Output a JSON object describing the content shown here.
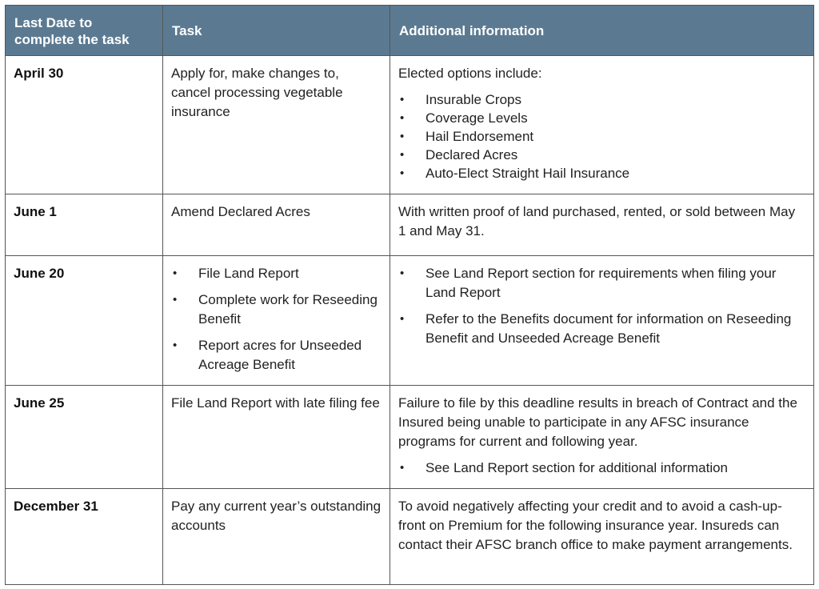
{
  "table": {
    "headers": [
      "Last Date to complete the task",
      "Task",
      "Additional information"
    ],
    "rows": [
      {
        "date": "April 30",
        "task": "Apply for, make changes to, cancel processing vegetable insurance",
        "info_text": "Elected options include:",
        "info_bullets": [
          "Insurable Crops",
          "Coverage Levels",
          "Hail Endorsement",
          "Declared Acres",
          "Auto-Elect Straight Hail Insurance"
        ]
      },
      {
        "date": "June 1",
        "task": "Amend Declared Acres",
        "info_text": "With written proof of land purchased, rented, or sold between May 1 and May 31."
      },
      {
        "date": "June 20",
        "task_bullets": [
          "File Land Report",
          "Complete work for Reseeding Benefit",
          "Report acres for Unseeded Acreage Benefit"
        ],
        "info_bullets": [
          "See Land Report section for requirements when filing your Land Report",
          "Refer to the Benefits document for information on Reseeding Benefit and Unseeded Acreage Benefit"
        ]
      },
      {
        "date": "June 25",
        "task": "File Land Report with late filing fee",
        "info_text": "Failure to file by this deadline results in breach of Contract and the Insured being unable to participate in any AFSC insurance programs for current and following year.",
        "info_bullets": [
          "See Land Report section for additional information"
        ]
      },
      {
        "date": "December 31",
        "task": "Pay any current year’s outstanding accounts",
        "info_text": "To avoid negatively affecting your credit and to avoid a cash-up-front on Premium for the following insurance year. Insureds can contact their AFSC branch office to make payment arrangements."
      }
    ]
  },
  "colors": {
    "header_bg": "#5b7a92",
    "header_text": "#ffffff",
    "border": "#555555"
  }
}
